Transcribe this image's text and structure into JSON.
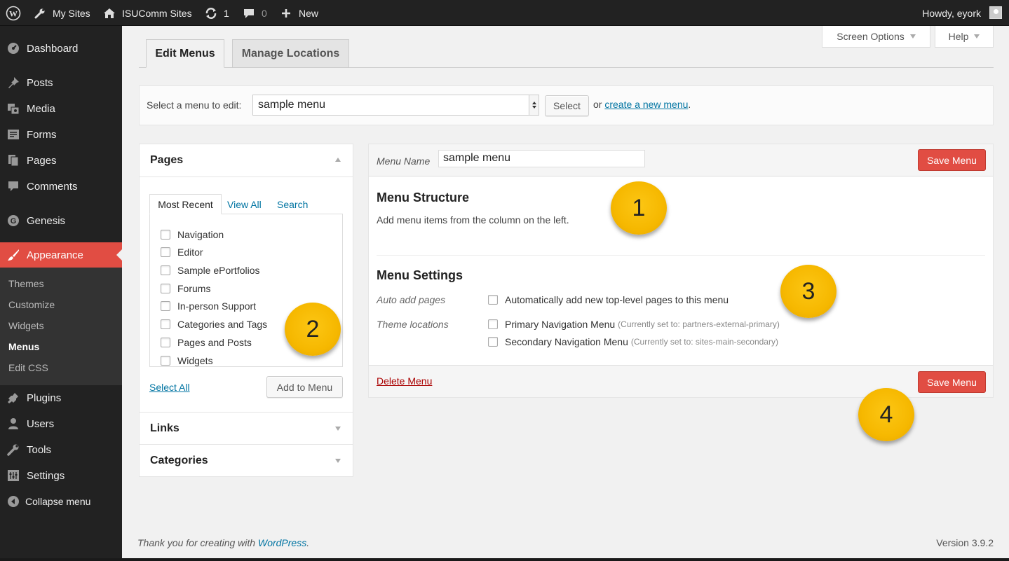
{
  "adminbar": {
    "my_sites": "My Sites",
    "site_name": "ISUComm Sites",
    "updates_count": "1",
    "comments_count": "0",
    "new_label": "New",
    "howdy": "Howdy, eyork"
  },
  "sidebar": {
    "items": [
      {
        "label": "Dashboard",
        "icon": "dashboard-icon"
      },
      {
        "label": "Posts",
        "icon": "pin-icon"
      },
      {
        "label": "Media",
        "icon": "media-icon"
      },
      {
        "label": "Forms",
        "icon": "forms-icon"
      },
      {
        "label": "Pages",
        "icon": "pages-icon"
      },
      {
        "label": "Comments",
        "icon": "comment-icon"
      },
      {
        "label": "Genesis",
        "icon": "genesis-icon"
      },
      {
        "label": "Appearance",
        "icon": "brush-icon"
      },
      {
        "label": "Plugins",
        "icon": "plugin-icon"
      },
      {
        "label": "Users",
        "icon": "users-icon"
      },
      {
        "label": "Tools",
        "icon": "wrench-icon"
      },
      {
        "label": "Settings",
        "icon": "settings-icon"
      },
      {
        "label": "Collapse menu",
        "icon": "collapse-icon"
      }
    ],
    "submenu": [
      "Themes",
      "Customize",
      "Widgets",
      "Menus",
      "Edit CSS"
    ]
  },
  "screen_options": "Screen Options",
  "help": "Help",
  "tabs": {
    "edit_menus": "Edit Menus",
    "manage_locations": "Manage Locations"
  },
  "manage": {
    "label": "Select a menu to edit:",
    "selected_menu": "sample menu",
    "select_button": "Select",
    "or_text": "or",
    "create_link": "create a new menu",
    "period": "."
  },
  "metabox": {
    "pages_title": "Pages",
    "tab_most_recent": "Most Recent",
    "tab_view_all": "View All",
    "tab_search": "Search",
    "pages": [
      "Navigation",
      "Editor",
      "Sample ePortfolios",
      "Forums",
      "In-person Support",
      "Categories and Tags",
      "Pages and Posts",
      "Widgets"
    ],
    "select_all": "Select All",
    "add_to_menu": "Add to Menu",
    "links_title": "Links",
    "categories_title": "Categories"
  },
  "menu_editor": {
    "name_label": "Menu Name",
    "name_value": "sample menu",
    "save_label": "Save Menu",
    "structure_title": "Menu Structure",
    "structure_desc": "Add menu items from the column on the left.",
    "settings_title": "Menu Settings",
    "auto_add_label": "Auto add pages",
    "auto_add_text": "Automatically add new top-level pages to this menu",
    "theme_locations_label": "Theme locations",
    "primary_nav": "Primary Navigation Menu",
    "primary_note": "(Currently set to: partners-external-primary)",
    "secondary_nav": "Secondary Navigation Menu",
    "secondary_note": "(Currently set to: sites-main-secondary)",
    "delete_label": "Delete Menu"
  },
  "callouts": [
    "1",
    "2",
    "3",
    "4"
  ],
  "footer": {
    "thanks_prefix": "Thank you for creating with",
    "wordpress": "WordPress",
    "thanks_suffix": ".",
    "version": "Version 3.9.2"
  },
  "colors": {
    "accent": "#e14d43",
    "link": "#0074a2",
    "adminbar": "#222222",
    "callout": "#f6b800"
  }
}
